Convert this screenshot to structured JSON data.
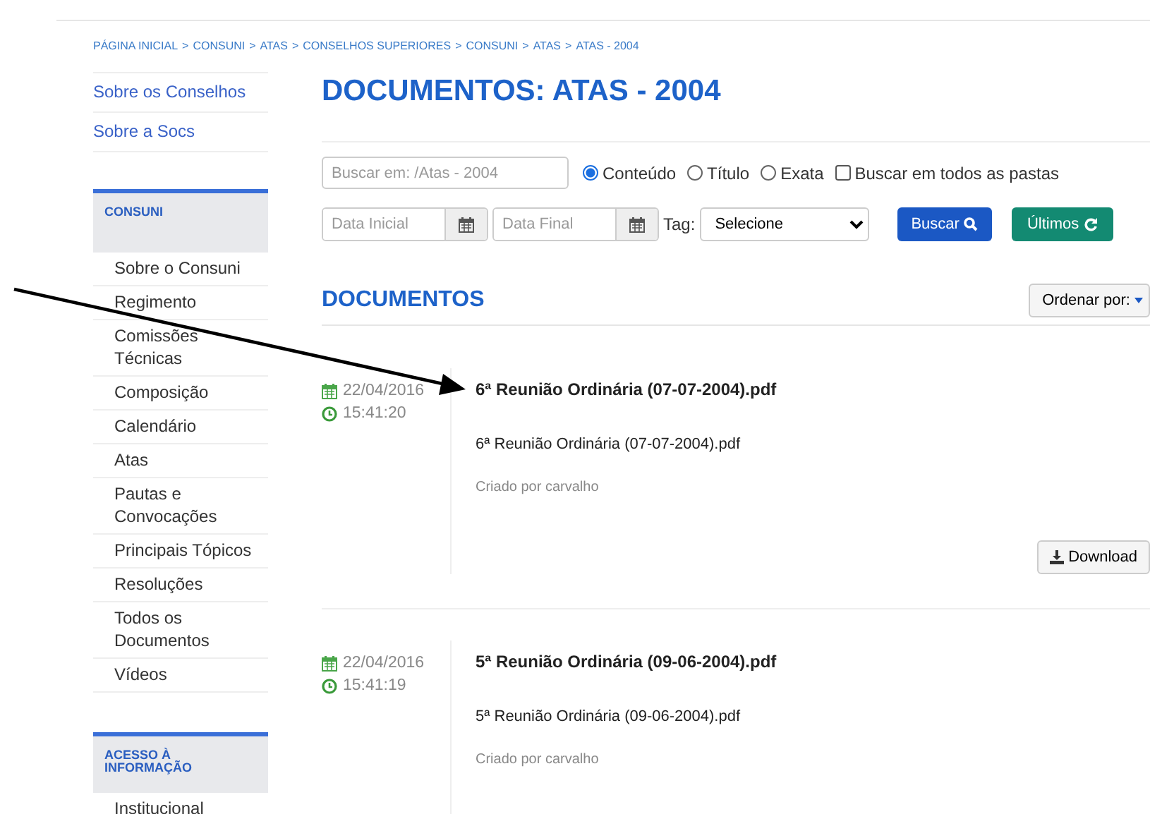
{
  "breadcrumb": {
    "items": [
      "PÁGINA INICIAL",
      "CONSUNI",
      "ATAS",
      "CONSELHOS SUPERIORES",
      "CONSUNI",
      "ATAS",
      "ATAS - 2004"
    ],
    "separator": ">"
  },
  "sidebar": {
    "links": [
      "Sobre os Conselhos",
      "Sobre a Socs"
    ],
    "sections": [
      {
        "title": "CONSUNI",
        "items": [
          "Sobre o Consuni",
          "Regimento",
          "Comissões Técnicas",
          "Composição",
          "Calendário",
          "Atas",
          "Pautas e Convocações",
          "Principais Tópicos",
          "Resoluções",
          "Todos os Documentos",
          "Vídeos"
        ]
      },
      {
        "title": "ACESSO À INFORMAÇÃO",
        "items": [
          "Institucional"
        ]
      }
    ]
  },
  "page_title": "DOCUMENTOS: ATAS - 2004",
  "search": {
    "placeholder": "Buscar em: /Atas - 2004",
    "options": [
      {
        "kind": "radio",
        "label": "Conteúdo",
        "selected": true
      },
      {
        "kind": "radio",
        "label": "Título",
        "selected": false
      },
      {
        "kind": "radio",
        "label": "Exata",
        "selected": false
      },
      {
        "kind": "checkbox",
        "label": "Buscar em todos as pastas",
        "checked": false
      }
    ],
    "date_start_placeholder": "Data Inicial",
    "date_end_placeholder": "Data Final",
    "tag_label": "Tag:",
    "tag_value": "Selecione",
    "search_button": "Buscar",
    "latest_button": "Últimos"
  },
  "documents": {
    "heading": "DOCUMENTOS",
    "sort_button": "Ordenar por:",
    "items": [
      {
        "date": "22/04/2016",
        "time": "15:41:20",
        "title": "6ª Reunião Ordinária (07-07-2004).pdf",
        "filename": "6ª Reunião Ordinária (07-07-2004).pdf",
        "author": "Criado por carvalho",
        "download": "Download"
      },
      {
        "date": "22/04/2016",
        "time": "15:41:19",
        "title": "5ª Reunião Ordinária (09-06-2004).pdf",
        "filename": "5ª Reunião Ordinária (09-06-2004).pdf",
        "author": "Criado por carvalho"
      }
    ]
  }
}
